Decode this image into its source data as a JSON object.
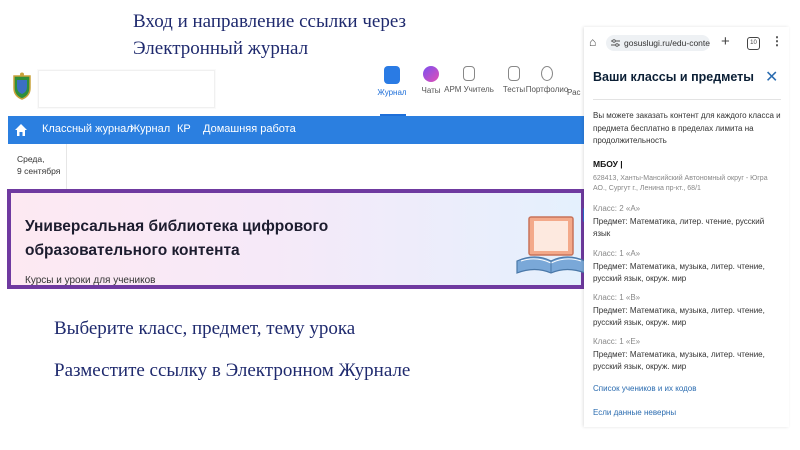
{
  "slide": {
    "title_line1": "Вход и направление  ссылки через",
    "title_line2": "Электронный журнал",
    "instruction1": "Выберите класс, предмет, тему урока",
    "instruction2": "Разместите ссылку в Электронном Журнале"
  },
  "journal": {
    "nav": [
      {
        "label": "Журнал",
        "active": true
      },
      {
        "label": "Чаты"
      },
      {
        "label": "АРМ Учитель"
      },
      {
        "label": "Тесты"
      },
      {
        "label": "Портфолио"
      },
      {
        "label": "Рас"
      }
    ],
    "menu": [
      "Классный журнал",
      "Журнал",
      "КР",
      "Домашняя работа"
    ],
    "date_line1": "Среда,",
    "date_line2": "9 сентября",
    "banner": {
      "title_line1": "Универсальная библиотека цифрового",
      "title_line2": "образовательного контента",
      "subtitle": "Курсы и уроки для учеников"
    }
  },
  "mobile": {
    "url": "gosuslugi.ru/edu-conte",
    "tabs_count": "10",
    "title": "Ваши классы и предметы",
    "intro": "Вы можете заказать контент для каждого класса и предмета бесплатно в пределах лимита на продолжительность",
    "school_name": "МБОУ |",
    "school_address": "628413, Ханты-Мансийский Автономный округ - Югра АО., Сургут г., Ленина пр-кт., 68/1",
    "classes": [
      {
        "class_label": "Класс: 2 «А»",
        "subjects": "Предмет: Математика, литер. чтение, русский язык"
      },
      {
        "class_label": "Класс: 1 «А»",
        "subjects": "Предмет: Математика, музыка, литер. чтение, русский язык, окруж. мир"
      },
      {
        "class_label": "Класс: 1 «В»",
        "subjects": "Предмет: Математика, музыка, литер. чтение, русский язык, окруж. мир"
      },
      {
        "class_label": "Класс: 1 «Е»",
        "subjects": "Предмет: Математика, музыка, литер. чтение, русский язык, окруж. мир"
      }
    ],
    "link_students": "Список учеников и их кодов",
    "link_wrong": "Если данные неверны"
  },
  "colors": {
    "accent_blue": "#2b7fe0",
    "banner_border": "#6f3aa0",
    "slide_text": "#1f2a6e",
    "link": "#2b6cb0"
  }
}
